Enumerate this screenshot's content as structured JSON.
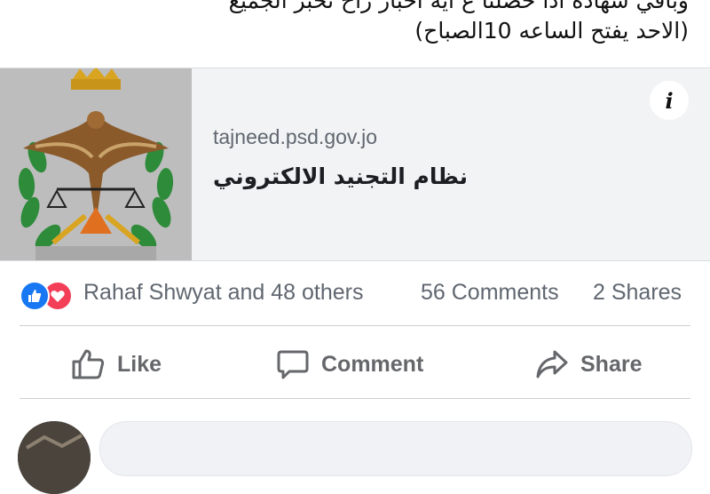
{
  "post": {
    "lines": [
      "وباقي شهادة اذا حصلنا ع اية اخبار راح نخبر الجميع",
      "(الاحد يفتح الساعه 10الصباح)"
    ]
  },
  "link_preview": {
    "domain": "tajneed.psd.gov.jo",
    "title": "نظام التجنيد الالكتروني",
    "info_label": "i",
    "thumbnail_icon": "jordan-public-security-emblem"
  },
  "stats": {
    "reactions": "Rahaf Shwyat and 48 others",
    "comments": "56 Comments",
    "shares": "2 Shares"
  },
  "actions": {
    "like": "Like",
    "comment": "Comment",
    "share": "Share"
  },
  "colors": {
    "like_blue": "#1877f2",
    "love_red": "#f33e58",
    "muted_text": "#606770"
  }
}
